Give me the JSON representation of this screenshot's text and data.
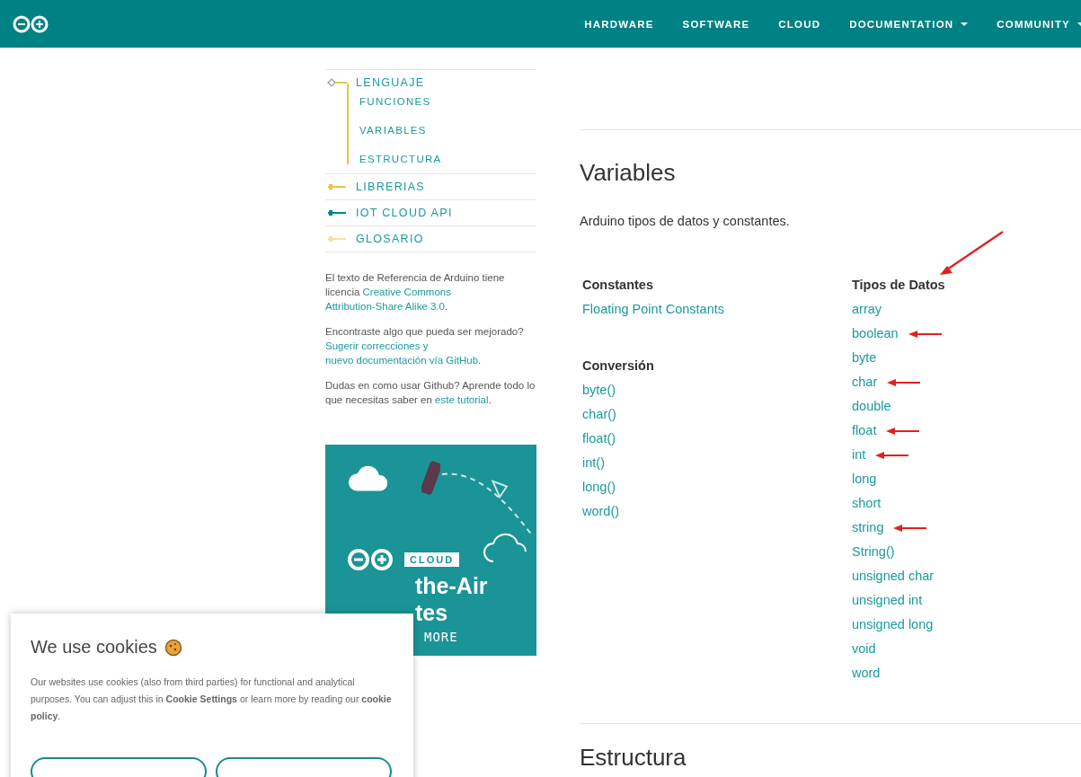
{
  "header": {
    "nav": [
      {
        "label": "HARDWARE",
        "dropdown": false
      },
      {
        "label": "SOFTWARE",
        "dropdown": false
      },
      {
        "label": "CLOUD",
        "dropdown": false
      },
      {
        "label": "DOCUMENTATION",
        "dropdown": true
      },
      {
        "label": "COMMUNITY",
        "dropdown": true
      }
    ]
  },
  "sidebar": {
    "nav": [
      {
        "label": "LENGUAJE",
        "expanded": true,
        "color": "#e8c547",
        "children": [
          {
            "label": "FUNCIONES"
          },
          {
            "label": "VARIABLES"
          },
          {
            "label": "ESTRUCTURA"
          }
        ]
      },
      {
        "label": "LIBRERIAS",
        "expanded": false,
        "color": "#e8c547"
      },
      {
        "label": "IOT CLOUD API",
        "expanded": false,
        "color": "#00878a"
      },
      {
        "label": "GLOSARIO",
        "expanded": false,
        "color": "#f3e49a"
      }
    ],
    "notes": [
      [
        {
          "text": "El texto de Referencia de Arduino tiene licencia "
        },
        {
          "text": "Creative Commons",
          "link": true
        },
        {
          "text": "Attribution-Share Alike 3.0",
          "link": true
        },
        {
          "text": "."
        }
      ],
      [
        {
          "text": "Encontraste algo que pueda ser mejorado? "
        },
        {
          "text": "Sugerir correcciones y",
          "link": true
        },
        {
          "text": "nuevo documentación vía GitHub",
          "link": true
        },
        {
          "text": "."
        }
      ],
      [
        {
          "text": "Dudas en como usar Github? Aprende todo lo que necesitas saber en "
        },
        {
          "text": "este tutorial",
          "link": true
        },
        {
          "text": "."
        }
      ]
    ],
    "banner": {
      "badge": "CLOUD",
      "lines": [
        "the-Air",
        "tes"
      ],
      "cta": "MORE"
    }
  },
  "content": {
    "title": "Variables",
    "description": "Arduino tipos de datos y constantes.",
    "columns": [
      {
        "marked": false,
        "groups": [
          {
            "heading": "Constantes",
            "items": [
              {
                "label": "Floating Point Constants",
                "marked": false
              }
            ]
          },
          {
            "heading": "Conversión",
            "items": [
              {
                "label": "byte()",
                "marked": false
              },
              {
                "label": "char()",
                "marked": false
              },
              {
                "label": "float()",
                "marked": false
              },
              {
                "label": "int()",
                "marked": false
              },
              {
                "label": "long()",
                "marked": false
              },
              {
                "label": "word()",
                "marked": false
              }
            ]
          }
        ]
      },
      {
        "marked": true,
        "groups": [
          {
            "heading": "Tipos de Datos",
            "items": [
              {
                "label": "array",
                "marked": false
              },
              {
                "label": "boolean",
                "marked": true
              },
              {
                "label": "byte",
                "marked": false
              },
              {
                "label": "char",
                "marked": true
              },
              {
                "label": "double",
                "marked": false
              },
              {
                "label": "float",
                "marked": true
              },
              {
                "label": "int",
                "marked": true
              },
              {
                "label": "long",
                "marked": false
              },
              {
                "label": "short",
                "marked": false
              },
              {
                "label": "string",
                "marked": true
              },
              {
                "label": "String()",
                "marked": false
              },
              {
                "label": "unsigned char",
                "marked": false
              },
              {
                "label": "unsigned int",
                "marked": false
              },
              {
                "label": "unsigned long",
                "marked": false
              },
              {
                "label": "void",
                "marked": false
              },
              {
                "label": "word",
                "marked": false
              }
            ]
          }
        ]
      }
    ],
    "next_title": "Estructura"
  },
  "cookie_dialog": {
    "title": "We use cookies",
    "body": "Our websites use cookies (also from third parties) for functional and analytical purposes. You can adjust this in **Cookie Settings** or learn more by reading our **cookie policy**."
  }
}
